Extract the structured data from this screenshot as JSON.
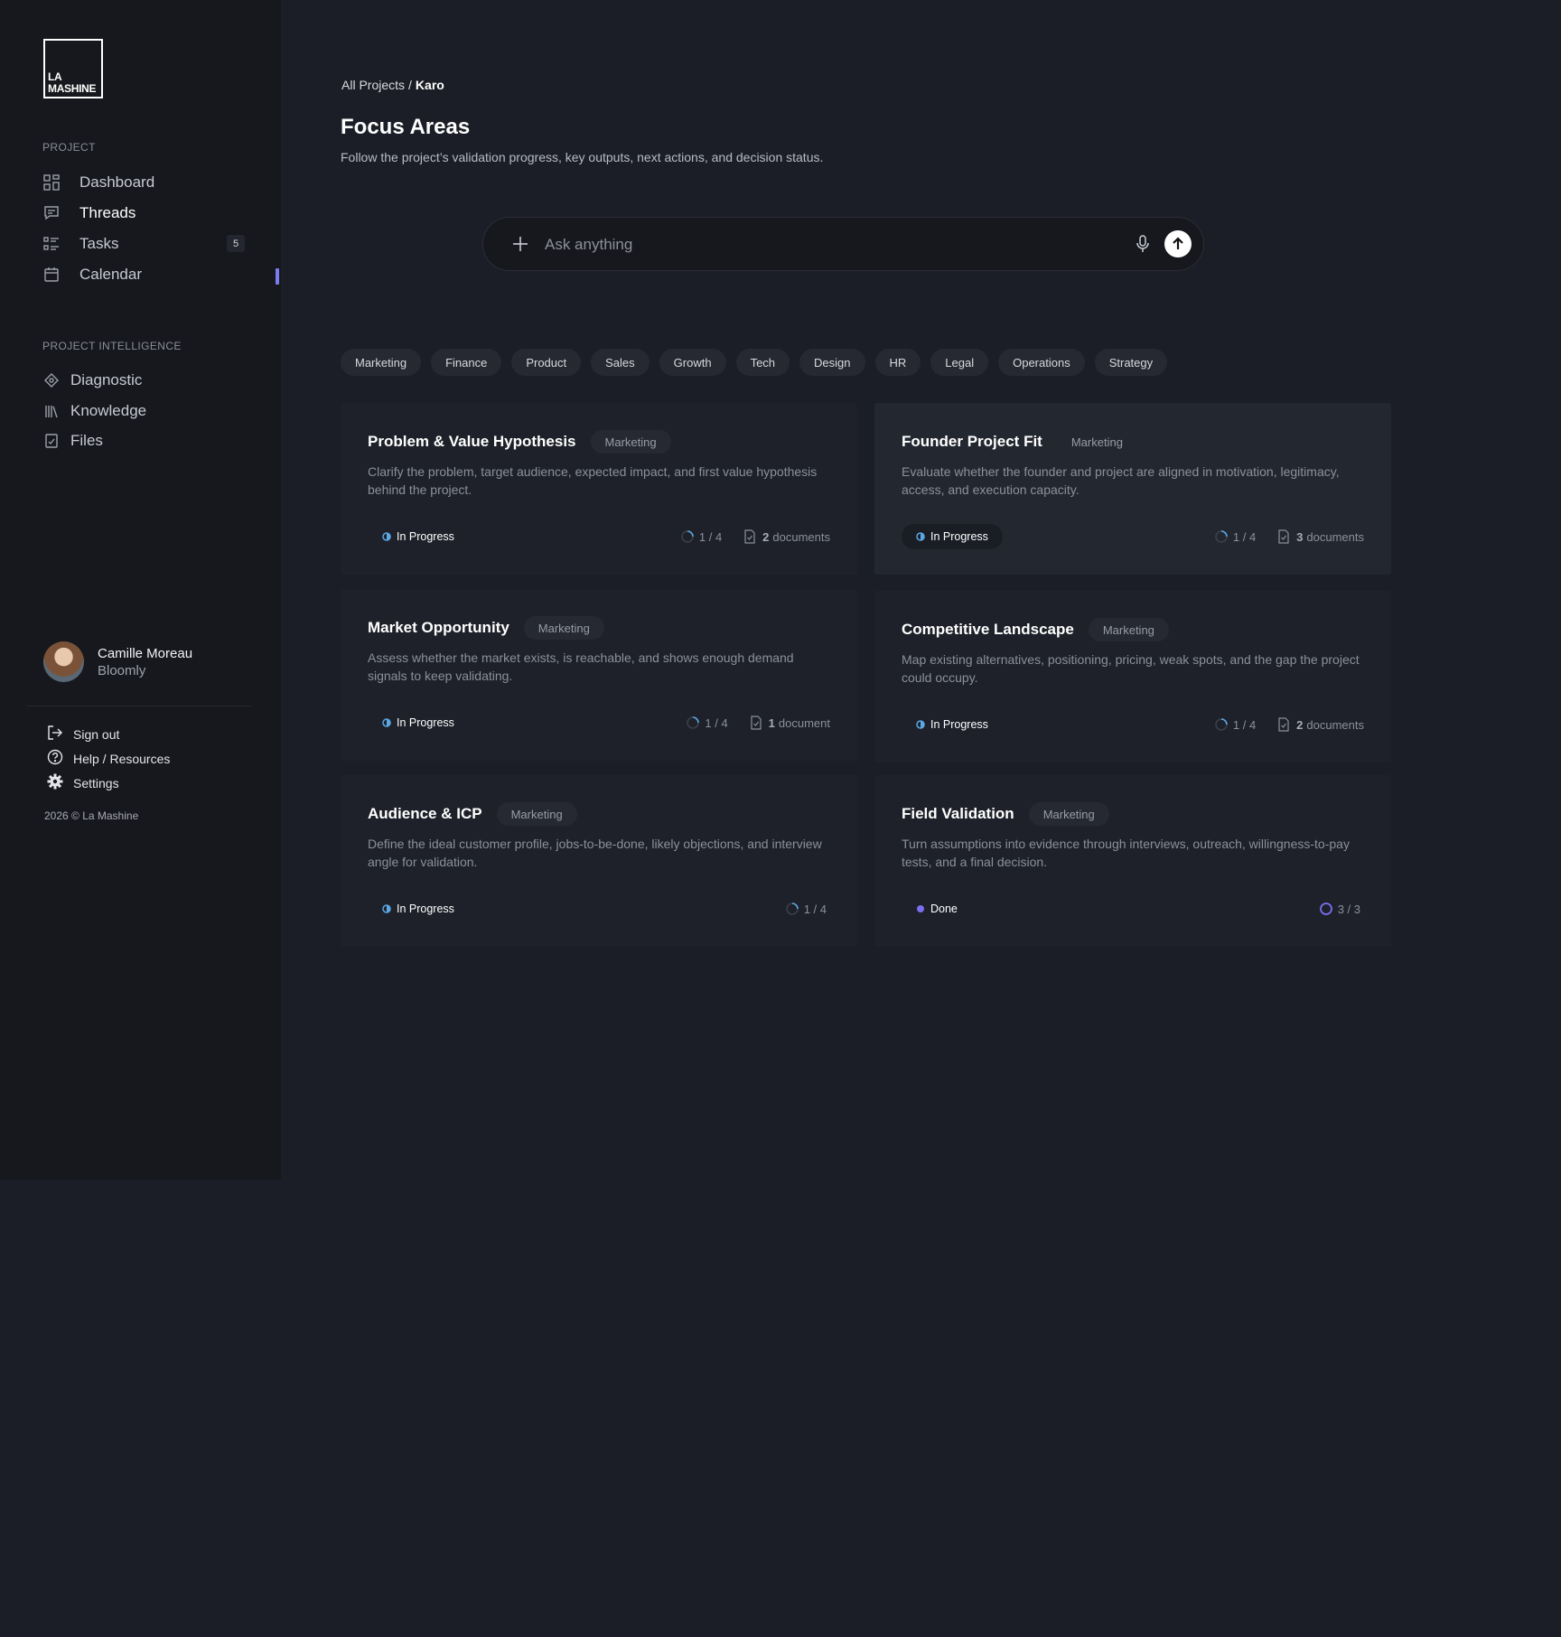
{
  "brand": {
    "logo_line1": "LA",
    "logo_line2": "MASHINE"
  },
  "sidebar": {
    "project_label": "PROJECT",
    "nav": [
      {
        "label": "Dashboard",
        "icon": "grid-icon"
      },
      {
        "label": "Threads",
        "icon": "chat-icon",
        "active": true
      },
      {
        "label": "Tasks",
        "icon": "list-icon",
        "badge": "5"
      },
      {
        "label": "Calendar",
        "icon": "calendar-icon"
      }
    ],
    "intel_label": "PROJECT INTELLIGENCE",
    "intel": [
      {
        "label": "Diagnostic",
        "icon": "diamond-icon"
      },
      {
        "label": "Knowledge",
        "icon": "books-icon"
      },
      {
        "label": "Files",
        "icon": "file-icon"
      }
    ],
    "user": {
      "name": "Camille Moreau",
      "org": "Bloomly"
    },
    "bottom": [
      {
        "label": "Sign out",
        "icon": "sign-out-icon"
      },
      {
        "label": "Help / Resources",
        "icon": "help-icon"
      },
      {
        "label": "Settings",
        "icon": "gear-icon"
      }
    ],
    "copyright": "2026 © La Mashine"
  },
  "breadcrumb": {
    "root": "All Projects",
    "sep": "/",
    "current": "Karo"
  },
  "page": {
    "title": "Focus Areas",
    "subtitle": "Follow the project’s validation progress, key outputs, next actions, and decision status."
  },
  "search": {
    "placeholder": "Ask anything"
  },
  "filters": [
    "Marketing",
    "Finance",
    "Product",
    "Sales",
    "Growth",
    "Tech",
    "Design",
    "HR",
    "Legal",
    "Operations",
    "Strategy"
  ],
  "cards": [
    {
      "title": "Problem & Value Hypothesis",
      "tag": "Marketing",
      "desc": "Clarify the problem, target audience, expected impact, and first value hypothesis behind the project.",
      "status": "In Progress",
      "progress": "1 / 4",
      "progress_fraction": 0.25,
      "doc_count": "2",
      "doc_label": "documents"
    },
    {
      "title": "Founder Project Fit",
      "tag": "Marketing",
      "desc": "Evaluate whether the founder and project are aligned in motivation, legitimacy, access, and execution capacity.",
      "status": "In Progress",
      "progress": "1 / 4",
      "progress_fraction": 0.25,
      "doc_count": "3",
      "doc_label": "documents"
    },
    {
      "title": "Market Opportunity",
      "tag": "Marketing",
      "desc": "Assess whether the market exists, is reachable, and shows enough demand signals to keep validating.",
      "status": "In Progress",
      "progress": "1 / 4",
      "progress_fraction": 0.25,
      "doc_count": "1",
      "doc_label": "document"
    },
    {
      "title": "Competitive Landscape",
      "tag": "Marketing",
      "desc": "Map existing alternatives, positioning, pricing, weak spots, and the gap the project could occupy.",
      "status": "In Progress",
      "progress": "1 / 4",
      "progress_fraction": 0.25,
      "doc_count": "2",
      "doc_label": "documents"
    },
    {
      "title": "Audience & ICP",
      "tag": "Marketing",
      "desc": "Define the ideal customer profile, jobs-to-be-done, likely objections, and interview angle for validation.",
      "status": "In Progress",
      "progress": "1 / 4",
      "progress_fraction": 0.25
    },
    {
      "title": "Field Validation",
      "tag": "Marketing",
      "desc": "Turn assumptions into evidence through interviews, outreach, willingness-to-pay tests, and a final decision.",
      "status": "Done",
      "progress": "3 / 3",
      "progress_fraction": 1.0
    }
  ],
  "colors": {
    "accent": "#7a7cf0",
    "in_progress": "#5aa8e6",
    "done": "#7b6ff0"
  }
}
